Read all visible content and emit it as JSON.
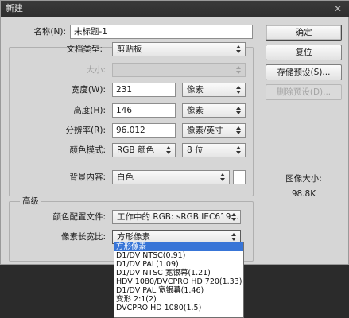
{
  "window": {
    "title": "新建",
    "close_glyph": "✕"
  },
  "form": {
    "name_label": "名称(N):",
    "name_value": "未标题-1",
    "preset_label": "文档类型:",
    "preset_value": "剪贴板",
    "size_label": "大小:",
    "width_label": "宽度(W):",
    "width_value": "231",
    "width_unit": "像素",
    "height_label": "高度(H):",
    "height_value": "146",
    "height_unit": "像素",
    "resolution_label": "分辨率(R):",
    "resolution_value": "96.012",
    "resolution_unit": "像素/英寸",
    "color_mode_label": "颜色模式:",
    "color_mode_value": "RGB 颜色",
    "bit_depth_value": "8 位",
    "background_label": "背景内容:",
    "background_value": "白色"
  },
  "advanced": {
    "section_label": "高级",
    "color_profile_label": "颜色配置文件:",
    "color_profile_value": "工作中的 RGB: sRGB IEC619...",
    "pixel_aspect_label": "像素长宽比:",
    "pixel_aspect_value": "方形像素"
  },
  "buttons": {
    "ok": "确定",
    "reset": "复位",
    "save_preset": "存储预设(S)...",
    "delete_preset": "删除预设(D)..."
  },
  "image_size": {
    "label": "图像大小:",
    "value": "98.8K"
  },
  "pixel_aspect_options": [
    "方形像素",
    "D1/DV NTSC(0.91)",
    "D1/DV PAL(1.09)",
    "D1/DV NTSC 宽银幕(1.21)",
    "HDV 1080/DVCPRO HD 720(1.33)",
    "D1/DV PAL 宽银幕(1.46)",
    "变形 2:1(2)",
    "DVCPRO HD 1080(1.5)"
  ],
  "pixel_aspect_selected_index": 0
}
